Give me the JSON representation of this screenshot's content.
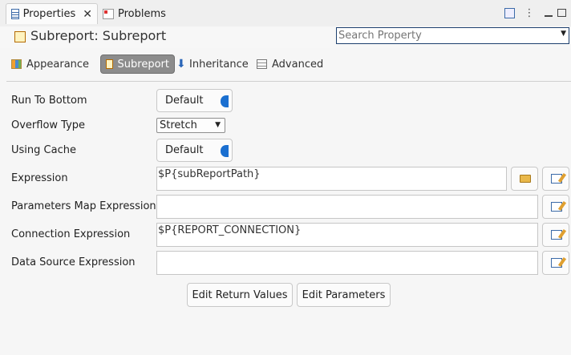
{
  "tabs": {
    "properties": "Properties",
    "problems": "Problems"
  },
  "title": "Subreport: Subreport",
  "search": {
    "placeholder": "Search Property"
  },
  "sections": {
    "appearance": "Appearance",
    "subreport": "Subreport",
    "inheritance": "Inheritance",
    "advanced": "Advanced"
  },
  "form": {
    "run_to_bottom": {
      "label": "Run To Bottom",
      "value": "Default"
    },
    "overflow_type": {
      "label": "Overflow Type",
      "value": "Stretch"
    },
    "using_cache": {
      "label": "Using Cache",
      "value": "Default"
    },
    "expression": {
      "label": "Expression",
      "value": "$P{subReportPath}"
    },
    "parameters_map_expression": {
      "label": "Parameters Map Expression",
      "value": ""
    },
    "connection_expression": {
      "label": "Connection Expression",
      "value": "$P{REPORT_CONNECTION}"
    },
    "data_source_expression": {
      "label": "Data Source Expression",
      "value": ""
    }
  },
  "buttons": {
    "edit_return_values": "Edit Return Values",
    "edit_parameters": "Edit Parameters"
  },
  "colors": {
    "accent": "#1a6fd0",
    "search_text": "#2a66b8",
    "selected_tab": "#8c8c8c"
  }
}
